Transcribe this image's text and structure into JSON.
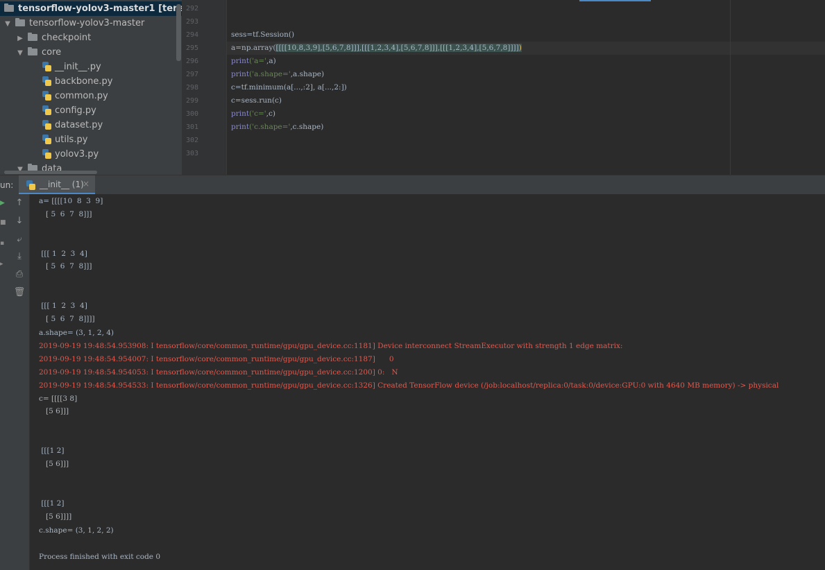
{
  "project_tree": {
    "items": [
      {
        "label": "tensorflow-yolov3-master1",
        "suffix": " [tensorflow-y",
        "kind": "project"
      },
      {
        "label": "tensorflow-yolov3-master",
        "kind": "folder"
      },
      {
        "label": "checkpoint",
        "kind": "folder"
      },
      {
        "label": "core",
        "kind": "folder"
      },
      {
        "label": "__init__.py",
        "kind": "file"
      },
      {
        "label": "backbone.py",
        "kind": "file"
      },
      {
        "label": "common.py",
        "kind": "file"
      },
      {
        "label": "config.py",
        "kind": "file"
      },
      {
        "label": "dataset.py",
        "kind": "file"
      },
      {
        "label": "utils.py",
        "kind": "file"
      },
      {
        "label": "yolov3.py",
        "kind": "file"
      },
      {
        "label": "data",
        "kind": "folder"
      }
    ]
  },
  "editor": {
    "line_numbers": [
      "292",
      "293",
      "294",
      "295",
      "296",
      "297",
      "298",
      "299",
      "300",
      "301",
      "302",
      "303"
    ],
    "lines": {
      "l294": "sess=tf.Session()",
      "l295_a": "a=np.array(",
      "l295_b": "[[[[10,8,3,9],[5,6,7,8]]],[[[1,2,3,4],[5,6,7,8]]],[[[1,2,3,4],[5,6,7,8]]]]",
      "l295_c": ")",
      "l296_kw": "print",
      "l296_s": "('a='",
      "l296_r": ",a)",
      "l297_kw": "print",
      "l297_s": "('a.shape='",
      "l297_r": ",a.shape)",
      "l298": "c=tf.minimum(a[...,:2], a[...,2:])",
      "l299": "c=sess.run(c)",
      "l300_kw": "print",
      "l300_s": "('c='",
      "l300_r": ",c)",
      "l301_kw": "print",
      "l301_s": "('c.shape='",
      "l301_r": ",c.shape)"
    }
  },
  "run_panel": {
    "label": "un:",
    "tab_label": "__init__ (1)",
    "tab_close": "×"
  },
  "console": {
    "lines": {
      "o1": "a= [[[[10  8  3  9]",
      "o2": "   [ 5  6  7  8]]]",
      "o3": " [[[ 1  2  3  4]",
      "o4": "   [ 5  6  7  8]]]",
      "o5": " [[[ 1  2  3  4]",
      "o6": "   [ 5  6  7  8]]]]",
      "o7": "a.shape= (3, 1, 2, 4)",
      "e1": "2019-09-19 19:48:54.953908: I tensorflow/core/common_runtime/gpu/gpu_device.cc:1181] Device interconnect StreamExecutor with strength 1 edge matrix:",
      "e2": "2019-09-19 19:48:54.954007: I tensorflow/core/common_runtime/gpu/gpu_device.cc:1187]      0",
      "e3": "2019-09-19 19:48:54.954053: I tensorflow/core/common_runtime/gpu/gpu_device.cc:1200] 0:   N",
      "e4": "2019-09-19 19:48:54.954533: I tensorflow/core/common_runtime/gpu/gpu_device.cc:1326] Created TensorFlow device (/job:localhost/replica:0/task:0/device:GPU:0 with 4640 MB memory) -> physical",
      "o8": "c= [[[[3 8]",
      "o9": "   [5 6]]]",
      "o10": " [[[1 2]",
      "o11": "   [5 6]]]",
      "o12": " [[[1 2]",
      "o13": "   [5 6]]]]",
      "o14": "c.shape= (3, 1, 2, 2)",
      "o15": "Process finished with exit code 0"
    }
  },
  "colors": {
    "panel_bg": "#3c3f41",
    "editor_bg": "#2b2b2b",
    "text": "#a9b7c6",
    "error_text": "#e05a4f",
    "string": "#6a8759",
    "builtin": "#8888c6",
    "accent": "#4a88c7"
  }
}
